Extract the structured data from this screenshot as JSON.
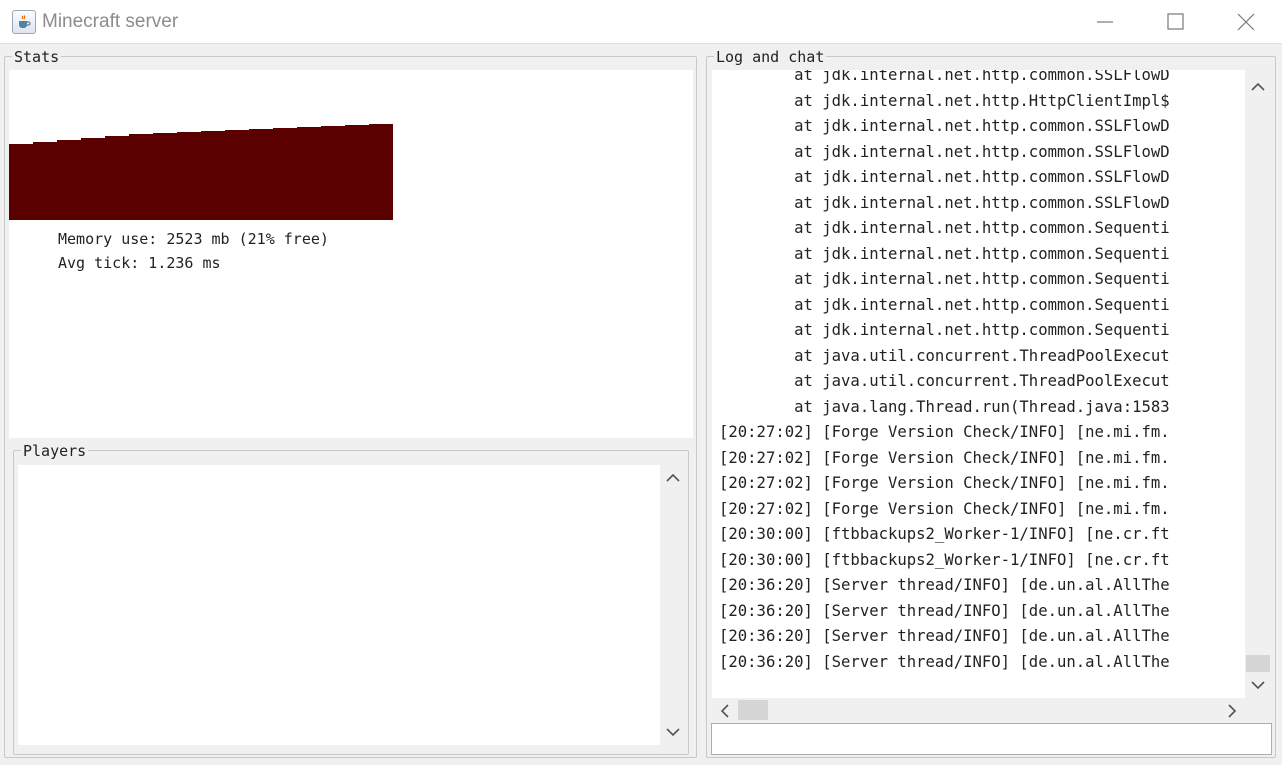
{
  "window": {
    "title": "Minecraft server",
    "app_icon": "java-coffee-icon"
  },
  "stats": {
    "title": "Stats",
    "memory_label": "Memory use: 2523 mb (21% free)",
    "tick_label": "Avg tick: 1.236 ms",
    "memory_free_percent": 21,
    "graph_color": "#5a0000"
  },
  "players": {
    "title": "Players",
    "items": []
  },
  "log": {
    "title": "Log and chat",
    "lines": [
      "        at jdk.internal.net.http.common.SSLFlowD",
      "        at jdk.internal.net.http.HttpClientImpl$",
      "        at jdk.internal.net.http.common.SSLFlowD",
      "        at jdk.internal.net.http.common.SSLFlowD",
      "        at jdk.internal.net.http.common.SSLFlowD",
      "        at jdk.internal.net.http.common.SSLFlowD",
      "        at jdk.internal.net.http.common.Sequenti",
      "        at jdk.internal.net.http.common.Sequenti",
      "        at jdk.internal.net.http.common.Sequenti",
      "        at jdk.internal.net.http.common.Sequenti",
      "        at jdk.internal.net.http.common.Sequenti",
      "        at java.util.concurrent.ThreadPoolExecut",
      "        at java.util.concurrent.ThreadPoolExecut",
      "        at java.lang.Thread.run(Thread.java:1583",
      "[20:27:02] [Forge Version Check/INFO] [ne.mi.fm.",
      "[20:27:02] [Forge Version Check/INFO] [ne.mi.fm.",
      "[20:27:02] [Forge Version Check/INFO] [ne.mi.fm.",
      "[20:27:02] [Forge Version Check/INFO] [ne.mi.fm.",
      "[20:30:00] [ftbbackups2_Worker-1/INFO] [ne.cr.ft",
      "[20:30:00] [ftbbackups2_Worker-1/INFO] [ne.cr.ft",
      "[20:36:20] [Server thread/INFO] [de.un.al.AllThe",
      "[20:36:20] [Server thread/INFO] [de.un.al.AllThe",
      "[20:36:20] [Server thread/INFO] [de.un.al.AllThe",
      "[20:36:20] [Server thread/INFO] [de.un.al.AllThe"
    ]
  },
  "chat": {
    "value": ""
  }
}
